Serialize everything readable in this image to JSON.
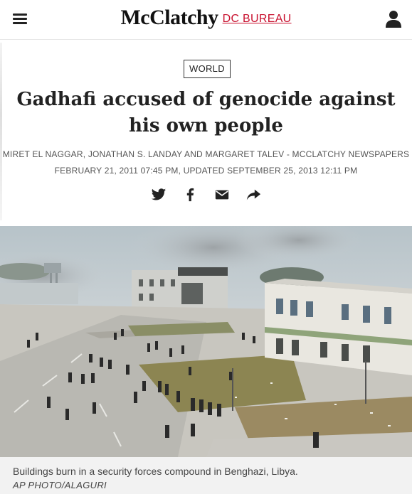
{
  "header": {
    "brand": "McClatchy",
    "bureau": "DC BUREAU"
  },
  "icons": {
    "menu": "hamburger-menu-icon",
    "account": "user-icon",
    "share": [
      "twitter-icon",
      "facebook-icon",
      "email-icon",
      "share-arrow-icon"
    ]
  },
  "colors": {
    "brand_accent": "#c8102e",
    "text": "#222222",
    "caption_bg": "#f2f2f2"
  },
  "article": {
    "section": "WORLD",
    "headline": "Gadhafi accused of genocide against his own people",
    "byline": "MIRET EL NAGGAR, JONATHAN S. LANDAY AND MARGARET TALEV - MCCLATCHY NEWSPAPERS",
    "dateline": "FEBRUARY 21, 2011 07:45 PM, UPDATED SEPTEMBER 25, 2013 12:11 PM"
  },
  "photo": {
    "caption": "Buildings burn in a security forces compound in Benghazi, Libya.",
    "credit": "AP PHOTO/ALAGURI"
  }
}
